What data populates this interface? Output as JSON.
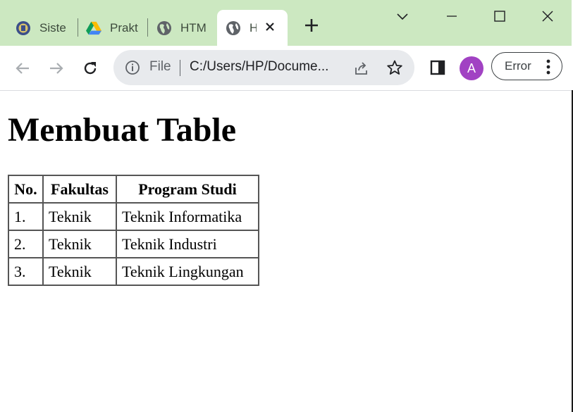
{
  "browser": {
    "tabs": [
      {
        "label": "Siste",
        "icon": "university-logo-icon"
      },
      {
        "label": "Prakt",
        "icon": "google-drive-icon"
      },
      {
        "label": "HTM",
        "icon": "globe-icon"
      },
      {
        "label": "H",
        "icon": "globe-icon",
        "active": true
      }
    ],
    "address": {
      "scheme_label": "File",
      "url": "C:/Users/HP/Docume..."
    },
    "profile_initial": "A",
    "error_button_label": "Error",
    "accent_color": "#cce8c1",
    "avatar_color": "#a142c3"
  },
  "page": {
    "heading": "Membuat Table",
    "table": {
      "headers": [
        "No.",
        "Fakultas",
        "Program Studi"
      ],
      "rows": [
        [
          "1.",
          "Teknik",
          "Teknik Informatika"
        ],
        [
          "2.",
          "Teknik",
          "Teknik Industri"
        ],
        [
          "3.",
          "Teknik",
          "Teknik Lingkungan"
        ]
      ]
    }
  }
}
